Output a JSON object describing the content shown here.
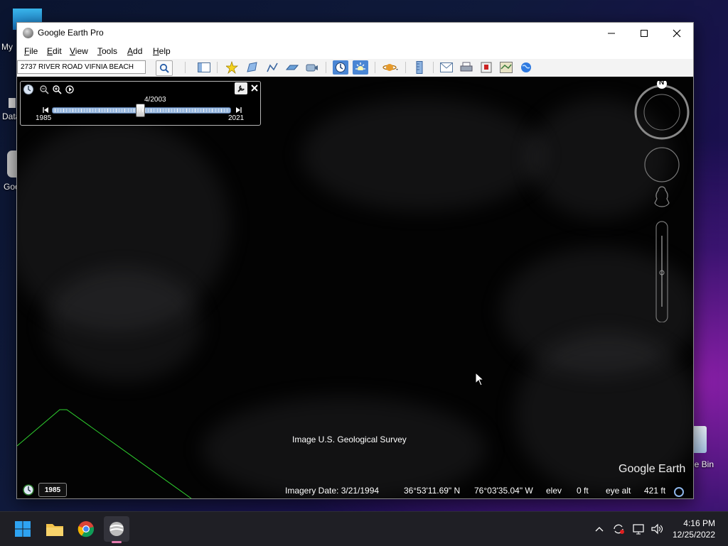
{
  "desktop": {
    "icons": [
      {
        "label": "My"
      },
      {
        "label": "Data"
      },
      {
        "label": "Goo"
      },
      {
        "label": "le Bin"
      }
    ]
  },
  "window": {
    "title": "Google Earth Pro",
    "controls": {
      "minimize": "—",
      "maximize": "☐",
      "close": "✕"
    }
  },
  "menu": {
    "items": [
      {
        "label": "File",
        "key": "F"
      },
      {
        "label": "Edit",
        "key": "E"
      },
      {
        "label": "View",
        "key": "V"
      },
      {
        "label": "Tools",
        "key": "T"
      },
      {
        "label": "Add",
        "key": "A"
      },
      {
        "label": "Help",
        "key": "H"
      }
    ]
  },
  "toolbar": {
    "search_value": "2737 RIVER ROAD VIFNIA BEACH",
    "buttons": [
      "search-icon",
      "sidebar-toggle-icon",
      "placemark-icon",
      "polygon-icon",
      "path-icon",
      "image-overlay-icon",
      "record-tour-icon",
      "historical-imagery-icon",
      "sunlight-icon",
      "planet-icon",
      "ruler-icon",
      "email-icon",
      "print-icon",
      "save-image-icon",
      "view-in-maps-icon",
      "earth-gallery-icon"
    ]
  },
  "timeslider": {
    "current": "4/2003",
    "start_year": "1985",
    "end_year": "2021",
    "position": 0.49
  },
  "map": {
    "attribution": "Image U.S. Geological Survey",
    "brand": "Google Earth",
    "compass_north": "N",
    "colors": {
      "boundary_line": "#2fd32f",
      "slider_fill": "#9cbbe0",
      "active_button": "#4a86d4"
    }
  },
  "status": {
    "year_badge": "1985",
    "imagery_date": "Imagery Date: 3/21/1994",
    "lat": "36°53'11.69\" N",
    "lon": "76°03'35.04\" W",
    "elev_label": "elev",
    "elev_value": "0 ft",
    "eye_alt_label": "eye alt",
    "eye_alt_value": "421 ft"
  },
  "taskbar": {
    "apps": [
      "windows-start-icon",
      "file-explorer-icon",
      "chrome-icon",
      "google-earth-icon"
    ],
    "time": "4:16 PM",
    "date": "12/25/2022"
  }
}
